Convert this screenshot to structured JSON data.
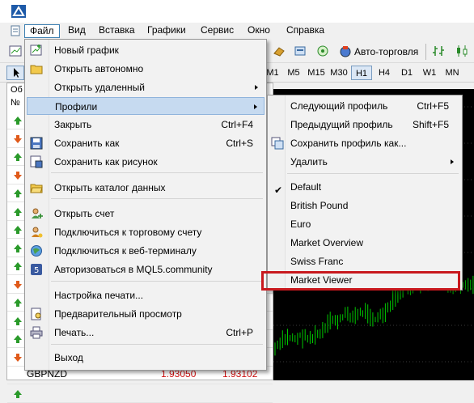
{
  "menubar": {
    "items": [
      "Файл",
      "Вид",
      "Вставка",
      "Графики",
      "Сервис",
      "Окно",
      "Справка"
    ]
  },
  "toolbar": {
    "autotrade_label": "Авто-торговля"
  },
  "timeframes": [
    "M1",
    "M5",
    "M15",
    "M30",
    "H1",
    "H4",
    "D1",
    "W1",
    "MN"
  ],
  "market_watch": {
    "title": "Об",
    "col": "№",
    "bottom_symbol": "GBPNZD",
    "bottom_bid": "1.93050",
    "bottom_ask": "1.93102",
    "arrows": [
      "up",
      "down",
      "up",
      "down",
      "up",
      "up",
      "up",
      "up",
      "up",
      "down",
      "up",
      "up",
      "up",
      "down",
      "up",
      "up"
    ]
  },
  "file_menu": {
    "items": [
      {
        "label": "Новый график",
        "shortcut": "",
        "icon": "new-chart-icon"
      },
      {
        "label": "Открыть автономно",
        "shortcut": "",
        "icon": "folder-icon"
      },
      {
        "label": "Открыть удаленный",
        "shortcut": "",
        "icon": ""
      },
      {
        "label": "Профили",
        "shortcut": "",
        "icon": ""
      },
      {
        "label": "Закрыть",
        "shortcut": "Ctrl+F4",
        "icon": ""
      },
      {
        "label": "Сохранить как",
        "shortcut": "Ctrl+S",
        "icon": "save-icon"
      },
      {
        "label": "Сохранить как рисунок",
        "shortcut": "",
        "icon": "save-picture-icon"
      },
      {
        "label": "Открыть каталог данных",
        "shortcut": "",
        "icon": "open-folder-icon"
      },
      {
        "label": "Открыть счет",
        "shortcut": "",
        "icon": "add-account-icon"
      },
      {
        "label": "Подключиться к торговому счету",
        "shortcut": "",
        "icon": "connect-account-icon"
      },
      {
        "label": "Подключиться к веб-терминалу",
        "shortcut": "",
        "icon": "web-terminal-icon"
      },
      {
        "label": "Авторизоваться в MQL5.community",
        "shortcut": "",
        "icon": "mql5-icon"
      },
      {
        "label": "Настройка печати...",
        "shortcut": "",
        "icon": ""
      },
      {
        "label": "Предварительный просмотр",
        "shortcut": "",
        "icon": "print-preview-icon"
      },
      {
        "label": "Печать...",
        "shortcut": "Ctrl+P",
        "icon": "printer-icon"
      },
      {
        "label": "Выход",
        "shortcut": "",
        "icon": ""
      }
    ]
  },
  "profiles_menu": {
    "items": [
      {
        "label": "Следующий профиль",
        "shortcut": "Ctrl+F5"
      },
      {
        "label": "Предыдущий профиль",
        "shortcut": "Shift+F5"
      },
      {
        "label": "Сохранить профиль как...",
        "shortcut": ""
      },
      {
        "label": "Удалить",
        "shortcut": ""
      },
      {
        "label": "Default",
        "shortcut": ""
      },
      {
        "label": "British Pound",
        "shortcut": ""
      },
      {
        "label": "Euro",
        "shortcut": ""
      },
      {
        "label": "Market Overview",
        "shortcut": ""
      },
      {
        "label": "Swiss Franc",
        "shortcut": ""
      },
      {
        "label": "Market Viewer",
        "shortcut": ""
      }
    ]
  },
  "colors": {
    "highlight": "#c6daf0",
    "redbox": "#c8191e",
    "up_arrow": "#2a9a2a",
    "down_arrow": "#e05a1a",
    "chart_bg": "#000000",
    "candle": "#00c800"
  }
}
